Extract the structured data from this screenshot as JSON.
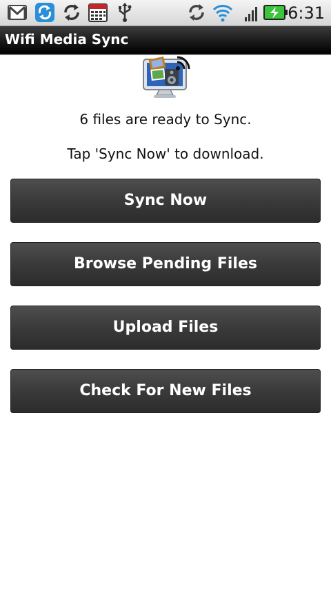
{
  "status_bar": {
    "icons": [
      "gmail-icon",
      "sync-app-icon",
      "sync-icon",
      "calendar-icon",
      "usb-icon",
      "data-sync-icon",
      "wifi-icon",
      "signal-icon",
      "battery-charging-icon"
    ],
    "time": "6:31"
  },
  "app": {
    "title": "Wifi Media Sync",
    "icon": "wifi-media-sync-app-icon"
  },
  "main": {
    "status_message": "6 files are ready to Sync.",
    "instruction": "Tap 'Sync Now' to download.",
    "buttons": {
      "sync_now": "Sync Now",
      "browse_pending": "Browse Pending Files",
      "upload": "Upload Files",
      "check_new": "Check For New Files"
    }
  },
  "colors": {
    "button_background": "#3a3a3a",
    "title_bar": "#111111",
    "status_bar": "#e0e0e0",
    "wifi_blue": "#2a8fd6",
    "battery_green": "#3cc43c"
  }
}
